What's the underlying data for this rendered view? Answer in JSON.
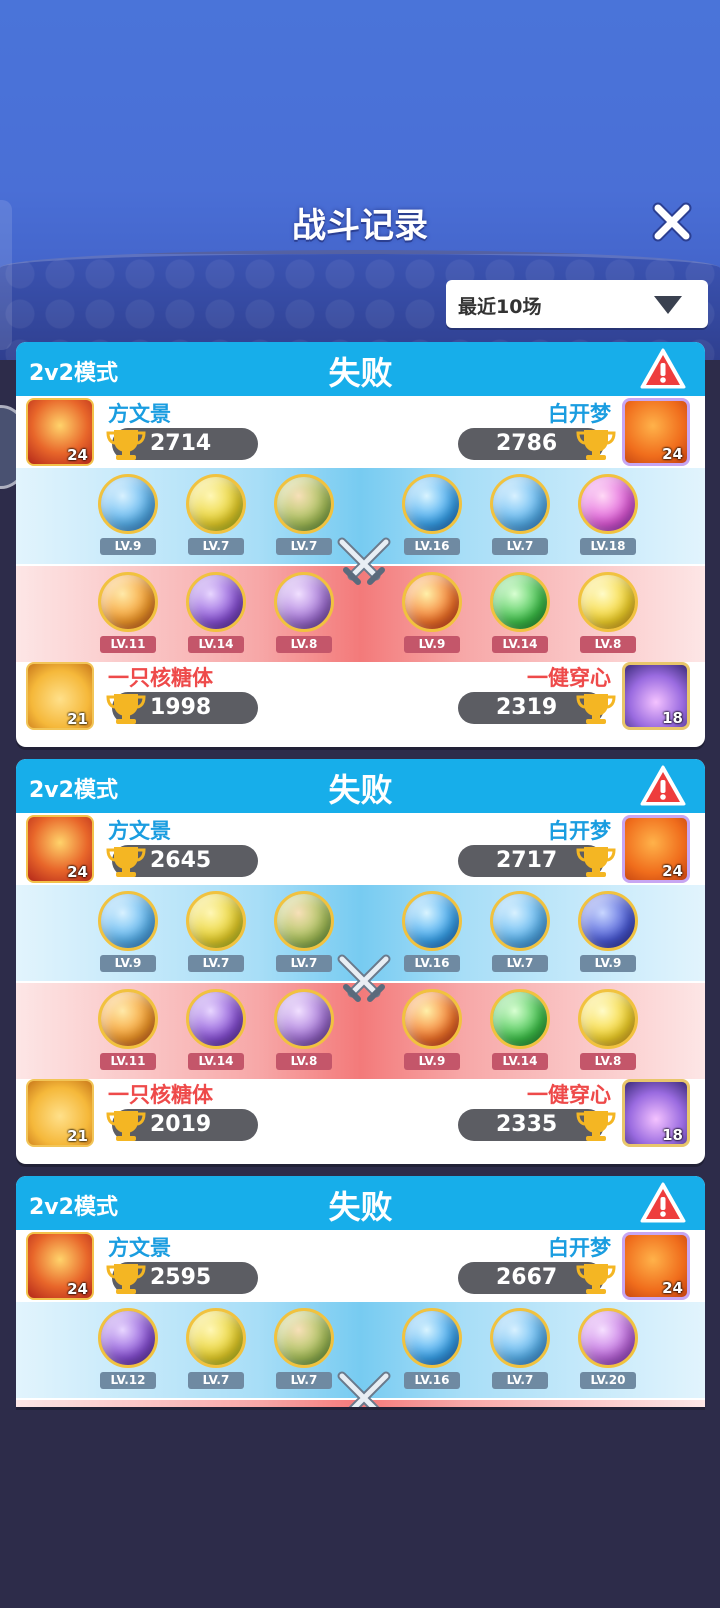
{
  "header": {
    "title": "战斗记录",
    "filter_label": "最近10场"
  },
  "battles": [
    {
      "mode": "2v2模式",
      "result": "失败",
      "team_top": {
        "left": {
          "name": "方文景",
          "score": "2714",
          "level": "24"
        },
        "right": {
          "name": "白开梦",
          "score": "2786",
          "level": "24"
        },
        "pets": [
          "LV.9",
          "LV.7",
          "LV.7",
          "LV.16",
          "LV.7",
          "LV.18"
        ]
      },
      "team_bottom": {
        "pets": [
          "LV.11",
          "LV.14",
          "LV.8",
          "LV.9",
          "LV.14",
          "LV.8"
        ],
        "left": {
          "name": "一只核糖体",
          "score": "1998",
          "level": "21"
        },
        "right": {
          "name": "一健穿心",
          "score": "2319",
          "level": "18"
        }
      }
    },
    {
      "mode": "2v2模式",
      "result": "失败",
      "team_top": {
        "left": {
          "name": "方文景",
          "score": "2645",
          "level": "24"
        },
        "right": {
          "name": "白开梦",
          "score": "2717",
          "level": "24"
        },
        "pets": [
          "LV.9",
          "LV.7",
          "LV.7",
          "LV.16",
          "LV.7",
          "LV.9"
        ]
      },
      "team_bottom": {
        "pets": [
          "LV.11",
          "LV.14",
          "LV.8",
          "LV.9",
          "LV.14",
          "LV.8"
        ],
        "left": {
          "name": "一只核糖体",
          "score": "2019",
          "level": "21"
        },
        "right": {
          "name": "一健穿心",
          "score": "2335",
          "level": "18"
        }
      }
    },
    {
      "mode": "2v2模式",
      "result": "失败",
      "team_top": {
        "left": {
          "name": "方文景",
          "score": "2595",
          "level": "24"
        },
        "right": {
          "name": "白开梦",
          "score": "2667",
          "level": "24"
        },
        "pets": [
          "LV.12",
          "LV.7",
          "LV.7",
          "LV.16",
          "LV.7",
          "LV.20"
        ]
      }
    }
  ],
  "pet_icons": {
    "top_1": [
      "sword-orb-icon",
      "yellow-creature-orb-icon",
      "monkey-orb-icon",
      "water-swirl-orb-icon",
      "sword-orb-icon",
      "pink-mushroom-orb-icon"
    ],
    "bottom_1": [
      "fire-beast-orb-icon",
      "purple-leaf-orb-icon",
      "purple-girl-orb-icon",
      "fire-star-orb-icon",
      "green-arrow-orb-icon",
      "yellow-sun-orb-icon"
    ],
    "top_2": [
      "sword-orb-icon",
      "yellow-creature-orb-icon",
      "monkey-orb-icon",
      "water-swirl-orb-icon",
      "sword-orb-icon",
      "blue-planet-orb-icon"
    ],
    "top_3": [
      "purple-leaf-orb-icon",
      "yellow-creature-orb-icon",
      "monkey-orb-icon",
      "water-swirl-orb-icon",
      "sword-orb-icon",
      "purple-cloud-orb-icon"
    ]
  },
  "colors": {
    "header_blue": "#17aeea",
    "loss_red": "#ee4a4a",
    "name_blue": "#1a9de0",
    "score_pill": "#5c5d63",
    "page_bg": "#2d2c4a"
  }
}
